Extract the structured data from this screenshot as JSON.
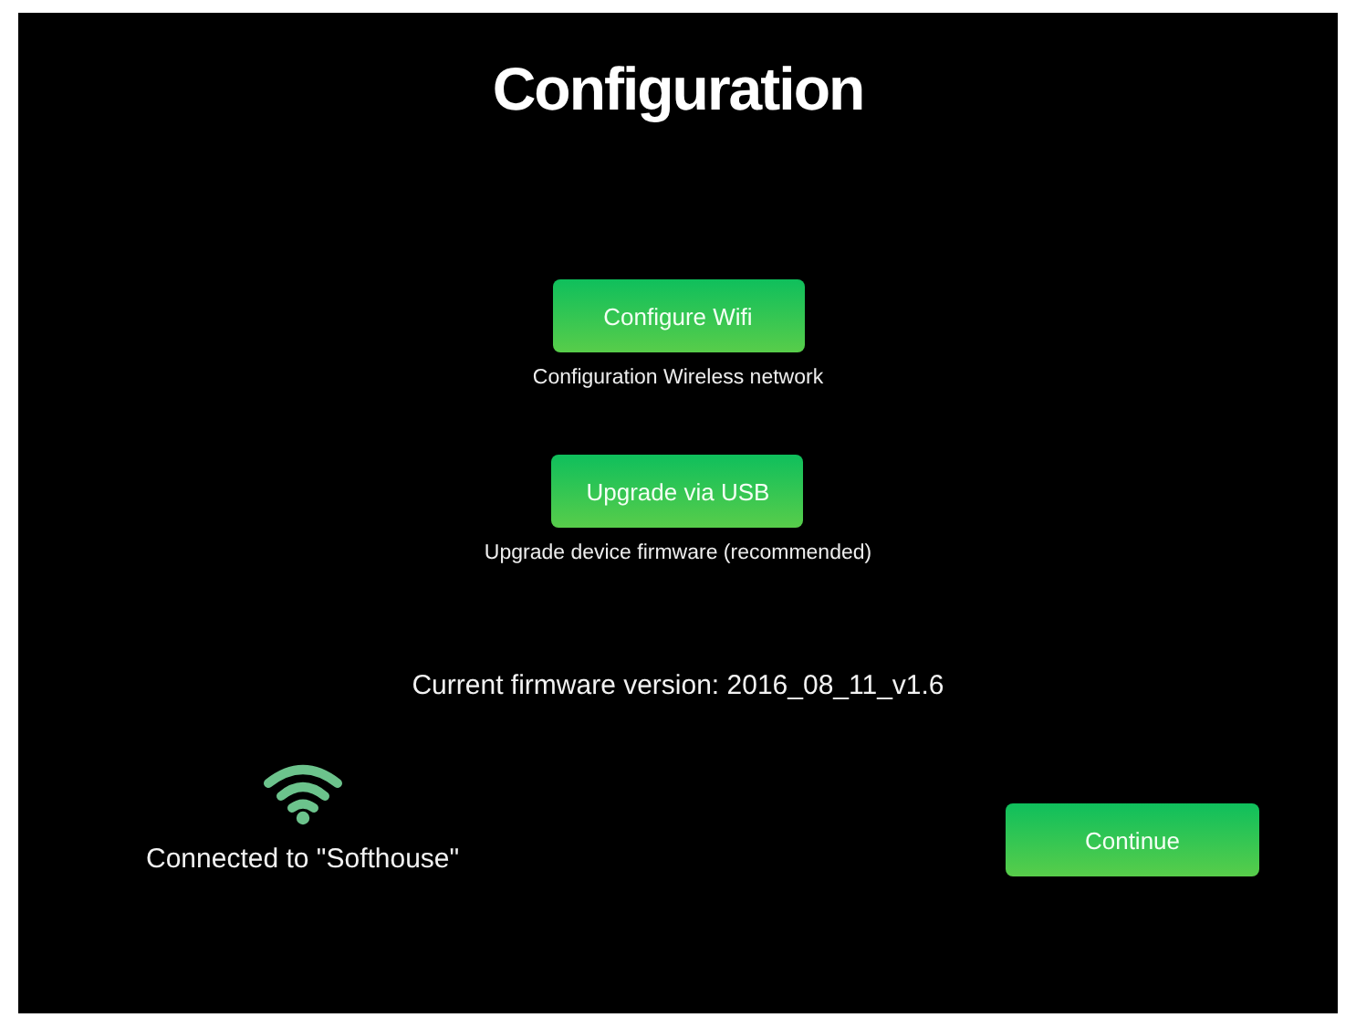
{
  "title": "Configuration",
  "actions": [
    {
      "label": "Configure Wifi",
      "caption": "Configuration Wireless network"
    },
    {
      "label": "Upgrade via USB",
      "caption": "Upgrade device firmware (recommended)"
    }
  ],
  "firmware_version": "Current firmware version: 2016_08_11_v1.6",
  "connection": {
    "status": "Connected to \"Softhouse\""
  },
  "continue_button": {
    "label": "Continue"
  }
}
